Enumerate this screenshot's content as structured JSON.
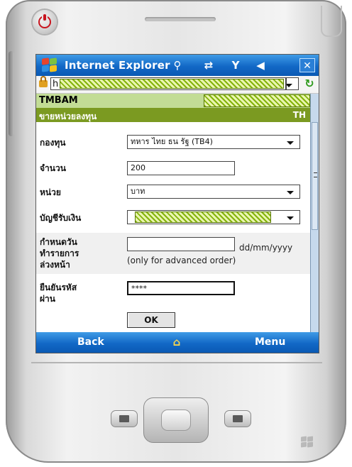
{
  "titlebar": {
    "title": "Internet Explorer",
    "icons": [
      "windows-start-icon",
      "connectivity-icon",
      "sync-icon",
      "signal-off-icon",
      "volume-icon"
    ],
    "close_label": "✕"
  },
  "addressbar": {
    "url_visible": "h"
  },
  "page": {
    "brand": "TMBAM",
    "section_title": "ขายหน่วยลงทุน",
    "language": "TH",
    "form": {
      "fund": {
        "label": "กองทุน",
        "value": "ทหาร ไทย ธน รัฐ (TB4)"
      },
      "amount": {
        "label": "จำนวน",
        "value": "200"
      },
      "unit": {
        "label": "หน่วย",
        "value": "บาท"
      },
      "account": {
        "label": "บัญชีรับเงิน",
        "value": ""
      },
      "date": {
        "label_line1": "กำหนดวัน",
        "label_line2": "ทำรายการ",
        "label_line3": "ล่วงหน้า",
        "value": "",
        "format_hint": "dd/mm/yyyy",
        "note": "(only for advanced order)"
      },
      "password": {
        "label_line1": "ยืนยันรหัส",
        "label_line2": "ผ่าน",
        "value": "****"
      },
      "ok_label": "OK"
    }
  },
  "menubar": {
    "left": "Back",
    "right": "Menu",
    "center_icon": "home-icon"
  },
  "colors": {
    "title_blue": "#1268c6",
    "header_light_green": "#c2dc95",
    "header_dark_green": "#7b9a21"
  }
}
